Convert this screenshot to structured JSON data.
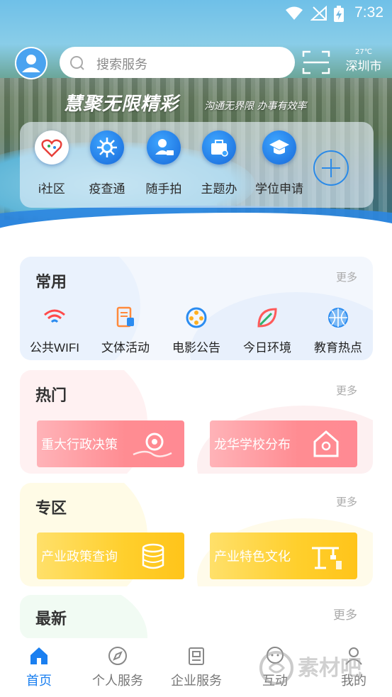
{
  "statusbar": {
    "time": "7:32"
  },
  "header": {
    "search_placeholder": "搜索服务",
    "weather_temp": "27℃",
    "weather_city": "深圳市"
  },
  "banner": {
    "slogan": "慧聚无限精彩",
    "slogan_sub": "沟通无界限 办事有效率"
  },
  "quick_services": [
    {
      "label": "i社区",
      "icon": "heart-community-icon"
    },
    {
      "label": "疫查通",
      "icon": "virus-icon"
    },
    {
      "label": "随手拍",
      "icon": "person-camera-icon"
    },
    {
      "label": "主题办",
      "icon": "briefcase-icon"
    },
    {
      "label": "学位申请",
      "icon": "graduation-cap-icon"
    }
  ],
  "common": {
    "title": "常用",
    "more": "更多",
    "items": [
      {
        "label": "公共WIFI",
        "icon": "wifi-icon",
        "color": "#ff4a4a"
      },
      {
        "label": "文体活动",
        "icon": "document-icon",
        "color": "#ff8a3c"
      },
      {
        "label": "电影公告",
        "icon": "film-reel-icon",
        "color": "#2b8cf0"
      },
      {
        "label": "今日环境",
        "icon": "leaf-icon",
        "color": "#ff5a5a"
      },
      {
        "label": "教育热点",
        "icon": "ball-icon",
        "color": "#2b8cf0"
      }
    ]
  },
  "hot": {
    "title": "热门",
    "more": "更多",
    "tiles": [
      {
        "label": "重大行政决策",
        "icon": "gear-hand-icon"
      },
      {
        "label": "龙华学校分布",
        "icon": "school-house-icon"
      }
    ]
  },
  "zone": {
    "title": "专区",
    "more": "更多",
    "tiles": [
      {
        "label": "产业政策查询",
        "icon": "coin-stack-icon"
      },
      {
        "label": "产业特色文化",
        "icon": "crane-icon"
      }
    ]
  },
  "latest": {
    "title": "最新",
    "more": "更多"
  },
  "bottom_nav": [
    {
      "label": "首页",
      "icon": "home-icon",
      "active": true
    },
    {
      "label": "个人服务",
      "icon": "compass-icon",
      "active": false
    },
    {
      "label": "企业服务",
      "icon": "building-icon",
      "active": false
    },
    {
      "label": "互动",
      "icon": "chat-icon",
      "active": false
    },
    {
      "label": "我的",
      "icon": "user-icon",
      "active": false
    }
  ],
  "watermark": "素材吧",
  "colors": {
    "accent": "#1a7ff0",
    "hot_tile": "#ff8c92",
    "zone_tile": "#ffcf2c"
  }
}
